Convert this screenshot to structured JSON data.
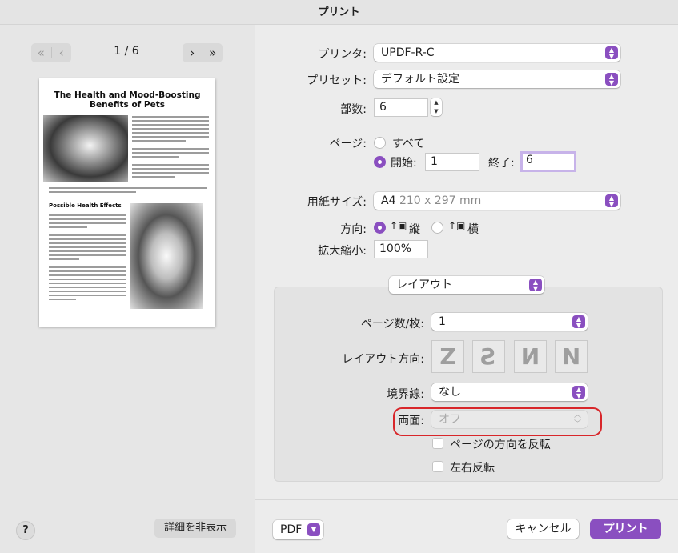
{
  "window": {
    "title": "プリント"
  },
  "preview": {
    "page_indicator": "1 / 6",
    "first_prev_icons": "≪ | ‹",
    "next_last_icons": "› | ≫",
    "document_title": "The Health and Mood-Boosting Benefits of Pets",
    "section_heading": "Possible Health Effects",
    "hide_details_label": "詳細を非表示",
    "help_label": "?"
  },
  "form": {
    "printer": {
      "label": "プリンタ:",
      "value": "UPDF-R-C"
    },
    "preset": {
      "label": "プリセット:",
      "value": "デフォルト設定"
    },
    "copies": {
      "label": "部数:",
      "value": "6"
    },
    "pages": {
      "label": "ページ:",
      "all_label": "すべて",
      "from_label": "開始:",
      "from_value": "1",
      "to_label": "終了:",
      "to_value": "6",
      "selected": "range"
    },
    "paper_size": {
      "label": "用紙サイズ:",
      "value": "A4",
      "detail": "210 x 297 mm"
    },
    "orientation": {
      "label": "方向:",
      "portrait_label": "縦",
      "landscape_label": "横",
      "selected": "portrait"
    },
    "scale": {
      "label": "拡大縮小:",
      "value": "100%"
    },
    "section_popup": "レイアウト",
    "pages_per_sheet": {
      "label": "ページ数/枚:",
      "value": "1"
    },
    "layout_direction": {
      "label": "レイアウト方向:"
    },
    "border": {
      "label": "境界線:",
      "value": "なし"
    },
    "two_sided": {
      "label": "両面:",
      "value": "オフ"
    },
    "reverse_orientation": {
      "label": "ページの方向を反転"
    },
    "flip_horizontal": {
      "label": "左右反転"
    }
  },
  "footer": {
    "pdf_label": "PDF",
    "cancel_label": "キャンセル",
    "print_label": "プリント"
  },
  "colors": {
    "accent": "#8a4fc0",
    "highlight_ring": "#d8262a"
  }
}
